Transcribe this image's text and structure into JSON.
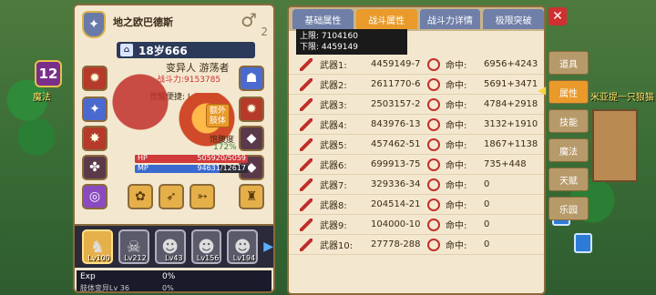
{
  "world": {
    "badge": "12",
    "text_left": "魔法",
    "text_right": "米亚提一只狼猫"
  },
  "hero": {
    "name": "地之欧巴德斯",
    "gender_icon": "male-symbol",
    "sub_value": "2",
    "level": "18岁666",
    "cls": "变异人 游荡者",
    "power": "战斗力:9153785",
    "awaken": "觉醒便捷: Lv 100",
    "extra": "额外肢体",
    "satiety_label": "饱腹度",
    "satiety_value": "172%",
    "hp_label": "HP",
    "hp_value": "505920/5059",
    "hp_fraction": 1.0,
    "mp_label": "MP",
    "mp_value": "94631/12617",
    "mp_fraction": 0.75
  },
  "pets": [
    {
      "level": "Lv100",
      "selected": true
    },
    {
      "level": "Lv212",
      "selected": false
    },
    {
      "level": "Lv43",
      "selected": false
    },
    {
      "level": "Lv156",
      "selected": false
    },
    {
      "level": "Lv194",
      "selected": false
    }
  ],
  "exp": {
    "label": "Exp",
    "value": "0%"
  },
  "sub_exp": {
    "label": "肢体变异Lv 36",
    "value": "0%"
  },
  "tabs": [
    {
      "label": "基础属性",
      "active": false
    },
    {
      "label": "战斗属性",
      "active": true
    },
    {
      "label": "战斗力详情",
      "active": false
    },
    {
      "label": "极限突破",
      "active": false
    }
  ],
  "limits": {
    "upper": "上限: 7104160",
    "lower": "下限: 4459149"
  },
  "rows": [
    {
      "name": "武器1:",
      "val": "4459149-7",
      "hit_label": "命中:",
      "hit": "6956+4243"
    },
    {
      "name": "武器2:",
      "val": "2611770-6",
      "hit_label": "命中:",
      "hit": "5691+3471"
    },
    {
      "name": "武器3:",
      "val": "2503157-2",
      "hit_label": "命中:",
      "hit": "4784+2918"
    },
    {
      "name": "武器4:",
      "val": "843976-13",
      "hit_label": "命中:",
      "hit": "3132+1910"
    },
    {
      "name": "武器5:",
      "val": "457462-51",
      "hit_label": "命中:",
      "hit": "1867+1138"
    },
    {
      "name": "武器6:",
      "val": "699913-75",
      "hit_label": "命中:",
      "hit": "735+448"
    },
    {
      "name": "武器7:",
      "val": "329336-34",
      "hit_label": "命中:",
      "hit": "0"
    },
    {
      "name": "武器8:",
      "val": "204514-21",
      "hit_label": "命中:",
      "hit": "0"
    },
    {
      "name": "武器9:",
      "val": "104000-10",
      "hit_label": "命中:",
      "hit": "0"
    },
    {
      "name": "武器10:",
      "val": "27778-288",
      "hit_label": "命中:",
      "hit": "0"
    }
  ],
  "side_menu": [
    {
      "label": "道具",
      "active": false
    },
    {
      "label": "属性",
      "active": true
    },
    {
      "label": "技能",
      "active": false
    },
    {
      "label": "魔法",
      "active": false
    },
    {
      "label": "天赋",
      "active": false
    },
    {
      "label": "乐园",
      "active": false
    }
  ],
  "close_icon": "close-x"
}
